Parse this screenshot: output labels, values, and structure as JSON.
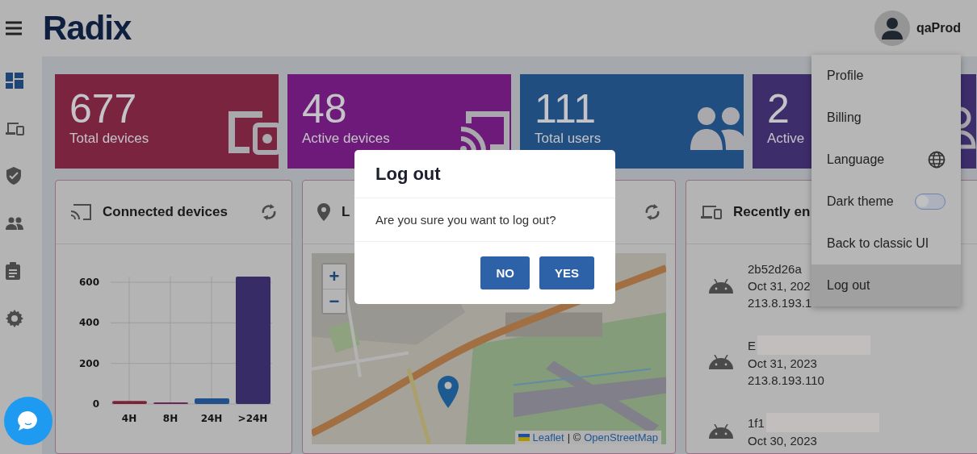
{
  "header": {
    "logo": "Radix",
    "user": "qaProd"
  },
  "sidebar": {
    "items": [
      {
        "kind": "dashboard",
        "selected": true
      },
      {
        "kind": "devices",
        "selected": false
      },
      {
        "kind": "security",
        "selected": false
      },
      {
        "kind": "users",
        "selected": false
      },
      {
        "kind": "reports",
        "selected": false
      },
      {
        "kind": "settings",
        "selected": false
      }
    ]
  },
  "stats": [
    {
      "kind": "devices",
      "value": "677",
      "label": "Total devices",
      "color": "#7a2440"
    },
    {
      "kind": "cast",
      "value": "48",
      "label": "Active devices",
      "color": "#6e1a7a"
    },
    {
      "kind": "users",
      "value": "111",
      "label": "Total users",
      "color": "#204e80"
    },
    {
      "kind": "user",
      "value": "2",
      "label": "Active",
      "color": "#3d2d6b"
    }
  ],
  "connected_panel": {
    "title": "Connected devices",
    "chart_data": {
      "type": "bar",
      "grid": true,
      "ylim": [
        0,
        640
      ],
      "yticks": [
        0,
        200,
        400,
        600
      ],
      "series": [
        {
          "name": "4H",
          "color": "#7c2236",
          "values": [
            15,
            null,
            null,
            null
          ]
        },
        {
          "name": "8H",
          "color": "#6b2660",
          "values": [
            null,
            2,
            null,
            null
          ]
        },
        {
          "name": "24H",
          "color": "#22508a",
          "values": [
            null,
            null,
            28,
            null
          ]
        },
        {
          "name": ">24H",
          "color": "#382c66",
          "values": [
            null,
            null,
            null,
            628
          ]
        }
      ]
    }
  },
  "location_panel": {
    "title": "L",
    "zoom_in": "+",
    "zoom_out": "−",
    "attribution": {
      "leaflet": "Leaflet",
      "separator": "| ©",
      "source": "OpenStreetMap"
    }
  },
  "recent_panel": {
    "title": "Recently en",
    "devices": [
      {
        "name": "2b52d26a",
        "date": "Oct 31, 202",
        "ip": "213.8.193.1",
        "redacted": false
      },
      {
        "name": "E",
        "date": "Oct 31, 2023",
        "ip": "213.8.193.110",
        "redacted": true
      },
      {
        "name": "1f1",
        "date": "Oct 30, 2023",
        "redacted": true
      }
    ]
  },
  "user_menu": {
    "items": [
      {
        "kind": "plain",
        "label": "Profile",
        "selected": false
      },
      {
        "kind": "plain",
        "label": "Billing",
        "selected": false
      },
      {
        "kind": "language",
        "label": "Language",
        "selected": false
      },
      {
        "kind": "toggle",
        "label": "Dark theme",
        "on": false,
        "selected": false
      },
      {
        "kind": "plain",
        "label": "Back to classic UI",
        "selected": false
      },
      {
        "kind": "plain",
        "label": "Log out",
        "selected": true
      }
    ]
  },
  "dialog": {
    "title": "Log out",
    "message": "Are you sure you want to log out?",
    "buttons": [
      {
        "label": "NO"
      },
      {
        "label": "YES"
      }
    ]
  }
}
